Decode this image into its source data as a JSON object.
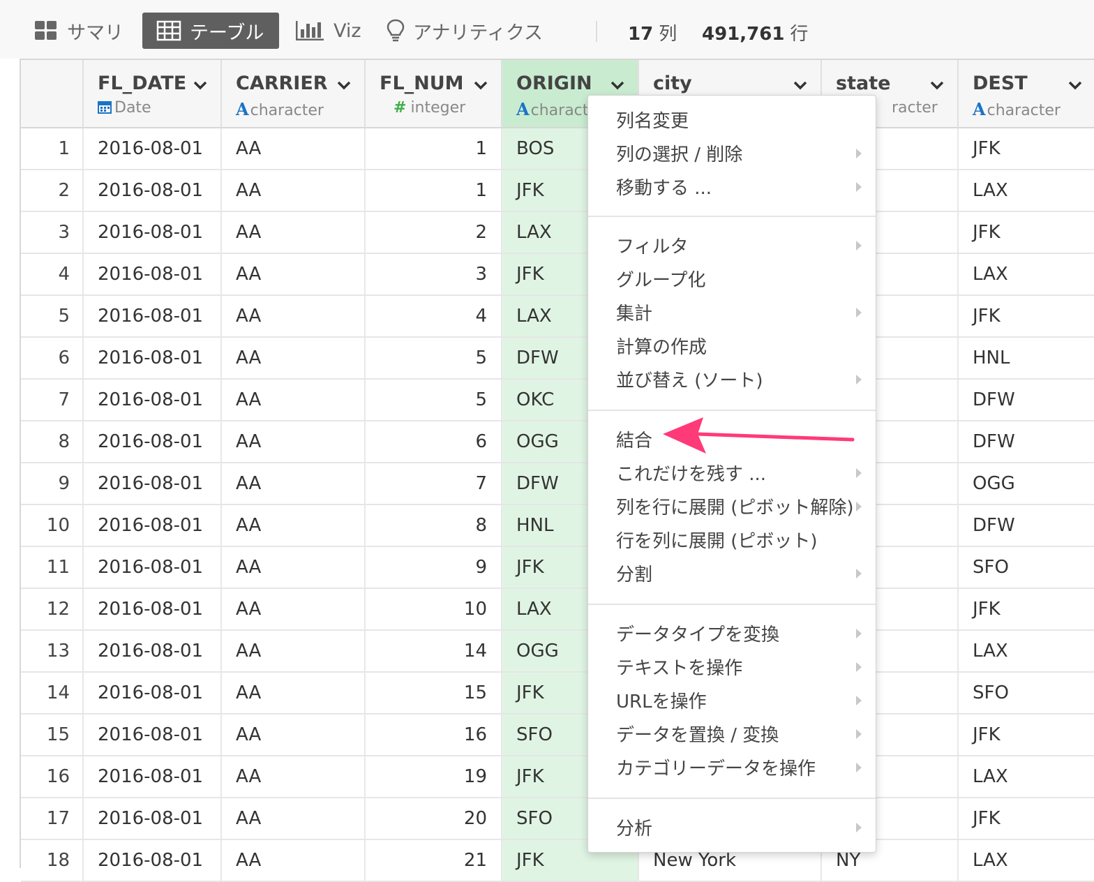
{
  "toolbar": {
    "tabs": [
      {
        "label": "サマリ",
        "icon": "grid-icon"
      },
      {
        "label": "テーブル",
        "icon": "table-icon",
        "active": true
      },
      {
        "label": "Viz",
        "icon": "bar-chart-icon"
      },
      {
        "label": "アナリティクス",
        "icon": "lightbulb-icon"
      }
    ],
    "columns_count": "17",
    "columns_unit": "列",
    "rows_count": "491,761",
    "rows_unit": "行"
  },
  "columns": [
    {
      "name": "FL_DATE",
      "type": "Date",
      "type_icon": "calendar-icon"
    },
    {
      "name": "CARRIER",
      "type": "character",
      "type_icon": "A"
    },
    {
      "name": "FL_NUM",
      "type": "integer",
      "type_icon": "#"
    },
    {
      "name": "ORIGIN",
      "type": "characte",
      "type_icon": "A"
    },
    {
      "name": "city",
      "type": "",
      "type_icon": ""
    },
    {
      "name": "state",
      "type": "racter",
      "type_icon": ""
    },
    {
      "name": "DEST",
      "type": "character",
      "type_icon": "A"
    }
  ],
  "rows": [
    {
      "i": "1",
      "date": "2016-08-01",
      "carrier": "AA",
      "num": "1",
      "origin": "BOS",
      "dest": "JFK"
    },
    {
      "i": "2",
      "date": "2016-08-01",
      "carrier": "AA",
      "num": "1",
      "origin": "JFK",
      "dest": "LAX"
    },
    {
      "i": "3",
      "date": "2016-08-01",
      "carrier": "AA",
      "num": "2",
      "origin": "LAX",
      "dest": "JFK"
    },
    {
      "i": "4",
      "date": "2016-08-01",
      "carrier": "AA",
      "num": "3",
      "origin": "JFK",
      "dest": "LAX"
    },
    {
      "i": "5",
      "date": "2016-08-01",
      "carrier": "AA",
      "num": "4",
      "origin": "LAX",
      "dest": "JFK"
    },
    {
      "i": "6",
      "date": "2016-08-01",
      "carrier": "AA",
      "num": "5",
      "origin": "DFW",
      "dest": "HNL"
    },
    {
      "i": "7",
      "date": "2016-08-01",
      "carrier": "AA",
      "num": "5",
      "origin": "OKC",
      "dest": "DFW"
    },
    {
      "i": "8",
      "date": "2016-08-01",
      "carrier": "AA",
      "num": "6",
      "origin": "OGG",
      "dest": "DFW"
    },
    {
      "i": "9",
      "date": "2016-08-01",
      "carrier": "AA",
      "num": "7",
      "origin": "DFW",
      "dest": "OGG"
    },
    {
      "i": "10",
      "date": "2016-08-01",
      "carrier": "AA",
      "num": "8",
      "origin": "HNL",
      "dest": "DFW"
    },
    {
      "i": "11",
      "date": "2016-08-01",
      "carrier": "AA",
      "num": "9",
      "origin": "JFK",
      "dest": "SFO"
    },
    {
      "i": "12",
      "date": "2016-08-01",
      "carrier": "AA",
      "num": "10",
      "origin": "LAX",
      "dest": "JFK"
    },
    {
      "i": "13",
      "date": "2016-08-01",
      "carrier": "AA",
      "num": "14",
      "origin": "OGG",
      "dest": "LAX"
    },
    {
      "i": "14",
      "date": "2016-08-01",
      "carrier": "AA",
      "num": "15",
      "origin": "JFK",
      "dest": "SFO"
    },
    {
      "i": "15",
      "date": "2016-08-01",
      "carrier": "AA",
      "num": "16",
      "origin": "SFO",
      "dest": "JFK"
    },
    {
      "i": "16",
      "date": "2016-08-01",
      "carrier": "AA",
      "num": "19",
      "origin": "JFK",
      "dest": "LAX"
    },
    {
      "i": "17",
      "date": "2016-08-01",
      "carrier": "AA",
      "num": "20",
      "origin": "SFO",
      "dest": "JFK"
    },
    {
      "i": "18",
      "date": "2016-08-01",
      "carrier": "AA",
      "num": "21",
      "origin": "JFK",
      "city": "New York",
      "state": "NY",
      "dest": "LAX"
    }
  ],
  "menu": {
    "items": [
      {
        "label": "列名変更",
        "submenu": false
      },
      {
        "label": "列の選択 / 削除",
        "submenu": true
      },
      {
        "label": "移動する ...",
        "submenu": true
      },
      {
        "label": "フィルタ",
        "submenu": true
      },
      {
        "label": "グループ化",
        "submenu": false
      },
      {
        "label": "集計",
        "submenu": true
      },
      {
        "label": "計算の作成",
        "submenu": false
      },
      {
        "label": "並び替え (ソート)",
        "submenu": true
      },
      {
        "label": "結合",
        "submenu": false
      },
      {
        "label": "これだけを残す ...",
        "submenu": true
      },
      {
        "label": "列を行に展開 (ピボット解除)",
        "submenu": true
      },
      {
        "label": "行を列に展開 (ピボット)",
        "submenu": false
      },
      {
        "label": "分割",
        "submenu": true
      },
      {
        "label": "データタイプを変換",
        "submenu": true
      },
      {
        "label": "テキストを操作",
        "submenu": true
      },
      {
        "label": "URLを操作",
        "submenu": true
      },
      {
        "label": "データを置換 / 変換",
        "submenu": true
      },
      {
        "label": "カテゴリーデータを操作",
        "submenu": true
      },
      {
        "label": "分析",
        "submenu": true
      }
    ]
  },
  "colors": {
    "accent_active_tab": "#5f5f5f",
    "selected_column": "#c9ecd0",
    "annotation_arrow": "#ff3a78"
  }
}
